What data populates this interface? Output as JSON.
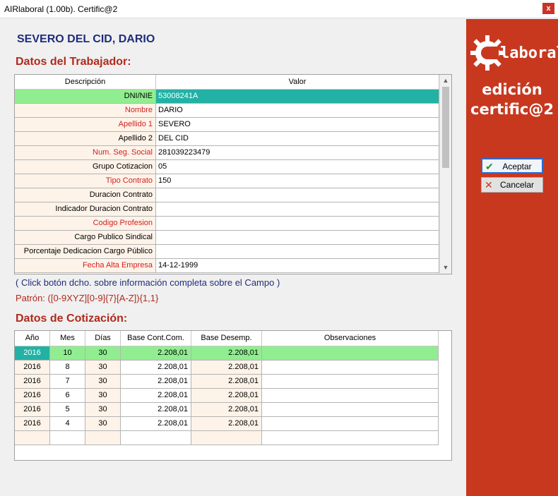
{
  "window": {
    "title": "AIRlaboral (1.00b). Certific@2",
    "close_label": "x"
  },
  "worker": {
    "name": "SEVERO DEL CID, DARIO"
  },
  "trabajador": {
    "section_title": "Datos del Trabajador:",
    "columns": [
      "Descripción",
      "Valor"
    ],
    "rows": [
      {
        "label": "DNI/NIE",
        "value": "53008241A"
      },
      {
        "label": "Nombre",
        "value": "DARIO"
      },
      {
        "label": "Apellido 1",
        "value": "SEVERO"
      },
      {
        "label": "Apellido 2",
        "value": "DEL CID"
      },
      {
        "label": "Num. Seg. Social",
        "value": "281039223479"
      },
      {
        "label": "Grupo Cotizacion",
        "value": "05"
      },
      {
        "label": "Tipo Contrato",
        "value": "150"
      },
      {
        "label": "Duracion Contrato",
        "value": ""
      },
      {
        "label": "Indicador Duracion Contrato",
        "value": ""
      },
      {
        "label": "Codigo Profesion",
        "value": ""
      },
      {
        "label": "Cargo Publico Sindical",
        "value": ""
      },
      {
        "label": "Porcentaje Dedicacion Cargo Público",
        "value": ""
      },
      {
        "label": "Fecha Alta Empresa",
        "value": "14-12-1999"
      }
    ],
    "hint": "( Click botón dcho. sobre información completa sobre el Campo )",
    "pattern": "Patrón: ([0-9XYZ][0-9]{7}[A-Z]){1,1}"
  },
  "cotizacion": {
    "section_title": "Datos de Cotización:",
    "columns": [
      "Año",
      "Mes",
      "Días",
      "Base Cont.Com.",
      "Base Desemp.",
      "Observaciones"
    ],
    "rows": [
      [
        "2016",
        "10",
        "30",
        "2.208,01",
        "2.208,01",
        ""
      ],
      [
        "2016",
        "8",
        "30",
        "2.208,01",
        "2.208,01",
        ""
      ],
      [
        "2016",
        "7",
        "30",
        "2.208,01",
        "2.208,01",
        ""
      ],
      [
        "2016",
        "6",
        "30",
        "2.208,01",
        "2.208,01",
        ""
      ],
      [
        "2016",
        "5",
        "30",
        "2.208,01",
        "2.208,01",
        ""
      ],
      [
        "2016",
        "4",
        "30",
        "2.208,01",
        "2.208,01",
        ""
      ],
      [
        "",
        "",
        "",
        "",
        "",
        ""
      ]
    ]
  },
  "side": {
    "logo_text": "laboral",
    "title_line1": "edición",
    "title_line2": "certific@2",
    "accept_label": "Aceptar",
    "cancel_label": "Cancelar",
    "accept_icon": "check-icon",
    "cancel_icon": "x-icon"
  },
  "colors": {
    "accent_red": "#c8381f",
    "selected_green": "#90ee90",
    "selected_teal": "#22b2a5",
    "title_blue": "#1f2d7a",
    "section_red": "#b02a1c"
  }
}
